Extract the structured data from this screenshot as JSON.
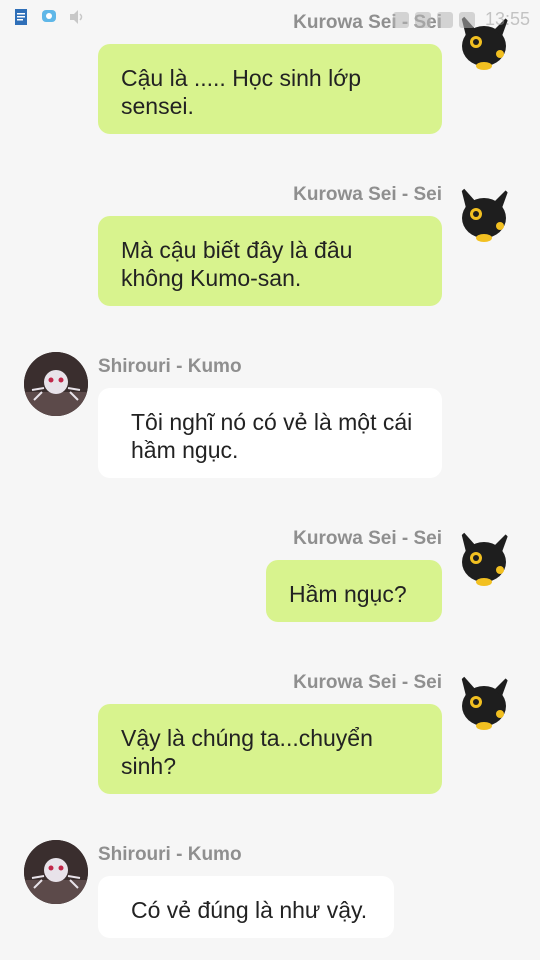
{
  "status_bar": {
    "time": "13:55",
    "left_icons": [
      "document-icon",
      "bubble-icon",
      "volume-icon"
    ],
    "right_icons": [
      "battery-icon",
      "cast-icon",
      "signal-icon",
      "wifi-icon"
    ]
  },
  "messages": [
    {
      "sender": "Kurowa Sei - Sei",
      "side": "right",
      "text": "Cậu là ..... Học sinh lớp sensei.",
      "avatar_icon": "umbreon-avatar-icon"
    },
    {
      "sender": "Kurowa Sei - Sei",
      "side": "right",
      "text": "Mà cậu biết đây là đâu không Kumo-san.",
      "avatar_icon": "umbreon-avatar-icon"
    },
    {
      "sender": "Shirouri - Kumo",
      "side": "left",
      "text": "Tôi nghĩ nó có vẻ là một cái hầm ngục.",
      "avatar_icon": "kumo-avatar-icon"
    },
    {
      "sender": "Kurowa Sei - Sei",
      "side": "right",
      "text": "Hầm ngục?",
      "avatar_icon": "umbreon-avatar-icon"
    },
    {
      "sender": "Kurowa Sei - Sei",
      "side": "right",
      "text": "Vậy là chúng ta...chuyển sinh?",
      "avatar_icon": "umbreon-avatar-icon"
    },
    {
      "sender": "Shirouri - Kumo",
      "side": "left",
      "text": "Có vẻ đúng là như vậy.",
      "avatar_icon": "kumo-avatar-icon"
    }
  ],
  "colors": {
    "background": "#f6f6f6",
    "outgoing_bubble": "#d8f38e",
    "incoming_bubble": "#ffffff",
    "sender_name": "#8f8f8f"
  }
}
